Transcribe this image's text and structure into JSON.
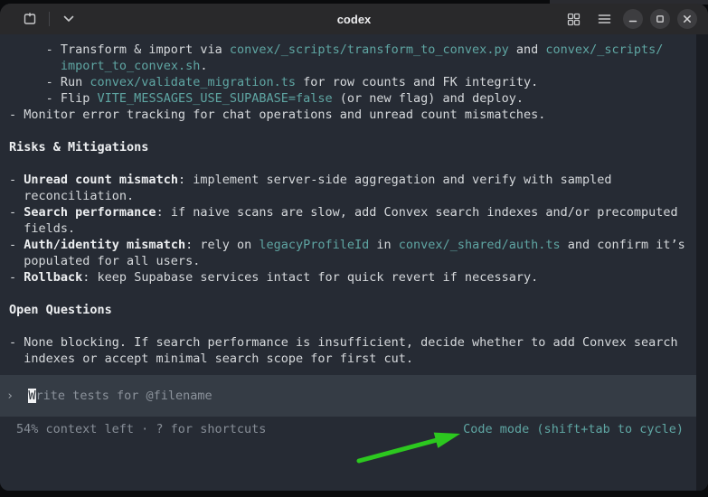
{
  "window": {
    "title": "codex",
    "titlebar_icons": [
      "new-tab-icon",
      "chevron-down-icon",
      "grid-layout-icon",
      "menu-icon",
      "minimize-icon",
      "maximize-icon",
      "close-icon"
    ]
  },
  "terminal": {
    "lines": [
      {
        "segments": [
          [
            "plain",
            "     - Transform & import via "
          ],
          [
            "code",
            "convex/_scripts/transform_to_convex.py"
          ],
          [
            "plain",
            " and "
          ],
          [
            "code",
            "convex/_scripts/"
          ]
        ]
      },
      {
        "segments": [
          [
            "plain",
            "       "
          ],
          [
            "code",
            "import_to_convex.sh"
          ],
          [
            "plain",
            "."
          ]
        ]
      },
      {
        "segments": [
          [
            "plain",
            "     - Run "
          ],
          [
            "code",
            "convex/validate_migration.ts"
          ],
          [
            "plain",
            " for row counts and FK integrity."
          ]
        ]
      },
      {
        "segments": [
          [
            "plain",
            "     - Flip "
          ],
          [
            "code",
            "VITE_MESSAGES_USE_SUPABASE=false"
          ],
          [
            "plain",
            " (or new flag) and deploy."
          ]
        ]
      },
      {
        "segments": [
          [
            "plain",
            "- Monitor error tracking for chat operations and unread count mismatches."
          ]
        ]
      },
      {
        "segments": []
      },
      {
        "segments": [
          [
            "bold",
            "Risks & Mitigations"
          ]
        ]
      },
      {
        "segments": []
      },
      {
        "segments": [
          [
            "plain",
            "- "
          ],
          [
            "bold",
            "Unread count mismatch"
          ],
          [
            "plain",
            ": implement server-side aggregation and verify with sampled"
          ]
        ]
      },
      {
        "segments": [
          [
            "plain",
            "  reconciliation."
          ]
        ]
      },
      {
        "segments": [
          [
            "plain",
            "- "
          ],
          [
            "bold",
            "Search performance"
          ],
          [
            "plain",
            ": if naive scans are slow, add Convex search indexes and/or precomputed"
          ]
        ]
      },
      {
        "segments": [
          [
            "plain",
            "  fields."
          ]
        ]
      },
      {
        "segments": [
          [
            "plain",
            "- "
          ],
          [
            "bold",
            "Auth/identity mismatch"
          ],
          [
            "plain",
            ": rely on "
          ],
          [
            "code",
            "legacyProfileId"
          ],
          [
            "plain",
            " in "
          ],
          [
            "code",
            "convex/_shared/auth.ts"
          ],
          [
            "plain",
            " and confirm it’s"
          ]
        ]
      },
      {
        "segments": [
          [
            "plain",
            "  populated for all users."
          ]
        ]
      },
      {
        "segments": [
          [
            "plain",
            "- "
          ],
          [
            "bold",
            "Rollback"
          ],
          [
            "plain",
            ": keep Supabase services intact for quick revert if necessary."
          ]
        ]
      },
      {
        "segments": []
      },
      {
        "segments": [
          [
            "bold",
            "Open Questions"
          ]
        ]
      },
      {
        "segments": []
      },
      {
        "segments": [
          [
            "plain",
            "- None blocking. If search performance is insufficient, decide whether to add Convex search"
          ]
        ]
      },
      {
        "segments": [
          [
            "plain",
            "  indexes or accept minimal search scope for first cut."
          ]
        ]
      }
    ]
  },
  "input": {
    "prompt": "›",
    "gap": "  ",
    "cursor_char": "W",
    "rest": "rite tests for @filename"
  },
  "status": {
    "left": "54% context left · ? for shortcuts",
    "right": "Code mode (shift+tab to cycle)"
  },
  "colors": {
    "terminal_bg": "#262b34",
    "input_band_bg": "#353c45",
    "titlebar_bg": "#29292b",
    "code_teal": "#5fa6a3",
    "dim_gray": "#8a9199",
    "arrow_green": "#2cc81f"
  }
}
